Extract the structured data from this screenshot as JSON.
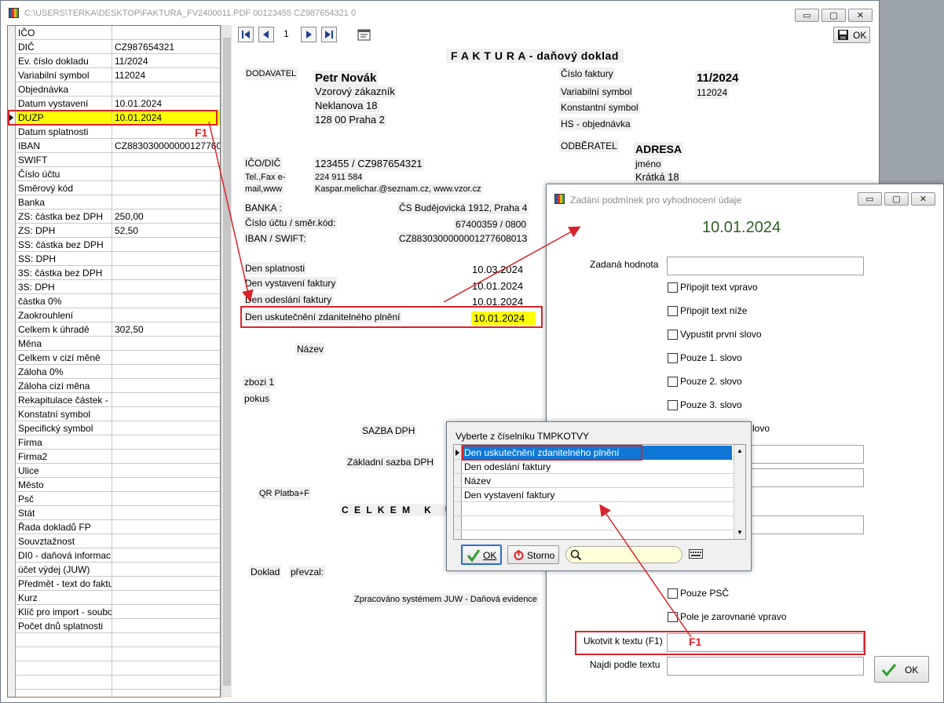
{
  "window": {
    "title": "C:\\USERS\\TERKA\\DESKTOP\\FAKTURA_FV2400011.PDF 00123455 CZ987654321 0",
    "min_glyph": "▭",
    "max_glyph": "▢",
    "close_glyph": "✕"
  },
  "grid": {
    "rows": [
      {
        "key": "IČO",
        "value": ""
      },
      {
        "key": "DIČ",
        "value": "CZ987654321"
      },
      {
        "key": "Ev. číslo dokladu",
        "value": "11/2024"
      },
      {
        "key": "Variabilní symbol",
        "value": "112024"
      },
      {
        "key": "Objednávka",
        "value": ""
      },
      {
        "key": "Datum vystavení",
        "value": "10.01.2024"
      },
      {
        "key": "DUZP",
        "value": "10.01.2024"
      },
      {
        "key": "Datum splatnosti",
        "value": ""
      },
      {
        "key": "IBAN",
        "value": "CZ883030000000127760"
      },
      {
        "key": "SWIFT",
        "value": ""
      },
      {
        "key": "Číslo účtu",
        "value": ""
      },
      {
        "key": "Směrový kód",
        "value": ""
      },
      {
        "key": "Banka",
        "value": ""
      },
      {
        "key": "ZS: částka bez DPH",
        "value": "250,00"
      },
      {
        "key": "ZS: DPH",
        "value": "52,50"
      },
      {
        "key": "SS: částka bez DPH",
        "value": ""
      },
      {
        "key": "SS: DPH",
        "value": ""
      },
      {
        "key": "3S: částka bez DPH",
        "value": ""
      },
      {
        "key": "3S: DPH",
        "value": ""
      },
      {
        "key": "částka 0%",
        "value": ""
      },
      {
        "key": "Zaokrouhlení",
        "value": ""
      },
      {
        "key": "Celkem k úhradě",
        "value": "302,50"
      },
      {
        "key": "Měna",
        "value": ""
      },
      {
        "key": "Celkem v cizí měně",
        "value": ""
      },
      {
        "key": "Záloha 0%",
        "value": ""
      },
      {
        "key": "Záloha cizí měna",
        "value": ""
      },
      {
        "key": "Rekapitulace částek -",
        "value": ""
      },
      {
        "key": "Konstatní symbol",
        "value": ""
      },
      {
        "key": "Specifický symbol",
        "value": ""
      },
      {
        "key": "Firma",
        "value": ""
      },
      {
        "key": "Firma2",
        "value": ""
      },
      {
        "key": "Ulice",
        "value": ""
      },
      {
        "key": "Město",
        "value": ""
      },
      {
        "key": "Psč",
        "value": ""
      },
      {
        "key": "Stát",
        "value": ""
      },
      {
        "key": "Řada dokladů FP",
        "value": ""
      },
      {
        "key": "Souvztažnost",
        "value": ""
      },
      {
        "key": "DI0 - daňová informac",
        "value": ""
      },
      {
        "key": "účet výdej (JUW)",
        "value": ""
      },
      {
        "key": "Předmět - text do faktu",
        "value": ""
      },
      {
        "key": "Kurz",
        "value": ""
      },
      {
        "key": "Klíč pro import - soubo",
        "value": ""
      },
      {
        "key": "Počet dnů splatnosti",
        "value": ""
      },
      {
        "key": "",
        "value": ""
      },
      {
        "key": "",
        "value": ""
      },
      {
        "key": "",
        "value": ""
      },
      {
        "key": "",
        "value": ""
      },
      {
        "key": "",
        "value": ""
      }
    ],
    "selected_index": 6
  },
  "toolbar": {
    "page": "1",
    "ok_label": "OK"
  },
  "pdf": {
    "title": "F A K T U R A - daňový doklad",
    "dodavatel_label": "DODAVATEL",
    "seller_name": "Petr Novák",
    "seller_line1": "Vzorový zákazník",
    "seller_line2": "Neklanova 18",
    "seller_line3": "128 00 Praha 2",
    "cislo_faktury_label": "Číslo faktury",
    "cislo_faktury_value": "11/2024",
    "var_symbol_label": "Variabilní symbol",
    "var_symbol_value": "112024",
    "konst_symbol_label": "Konstantní symbol",
    "hs_label": "HS - objednávka",
    "odberatel_label": "ODBĚRATEL",
    "buyer_name": "ADRESA",
    "buyer_line1": "jméno",
    "buyer_line2": "Krátká 18",
    "ico_label": "IČO/DIČ",
    "ico_value": "123455 / CZ987654321",
    "tel_label1": "Tel.,Fax e-",
    "tel_label2": "mail,www",
    "tel_value": "224 911 584",
    "email_value": "Kaspar.melichar.@seznam.cz, www.vzor.cz",
    "banka_label": "BANKA :",
    "banka_value": "ČS Budějovická 1912, Praha 4",
    "ucet_label": "Číslo účtu / směr.kód:",
    "ucet_value": "67400359 / 0800",
    "iban_label": "IBAN / SWIFT:",
    "iban_value": "CZ883030000000127760801З",
    "splatnost_label": "Den splatnosti",
    "splatnost_value": "10.03.2024",
    "vystaveni_label": "Den vystavení faktury",
    "vystaveni_value": "10.01.2024",
    "odeslani_label": "Den odeslání faktury",
    "odeslani_value": "10.01.2024",
    "duzp_label": "Den uskutečnění zdanitelného plnění",
    "duzp_value": "10.01.2024",
    "nazev_label": "Název",
    "item1": "zbozi 1",
    "item2": "pokus",
    "sazba_label": "SAZBA DPH",
    "zakladni_label": "Základní sazba DPH",
    "qr_label": "QR Platba+F",
    "celkem_label": "C E L K E M   K   Ú",
    "doklad_label": "Doklad",
    "prevzal_label": "převzal:",
    "footer": "Zpracováno systémem JUW - Daňová evidence"
  },
  "annotations": {
    "f1_grid": "F1",
    "f1_dialog": "F1",
    "accent": "#d8232a"
  },
  "dialog": {
    "title": "Zadání podmínek pro vyhodnocení údaje",
    "value": "10.01.2024",
    "zadana_label": "Zadaná hodnota",
    "zadana_value": "",
    "checkboxes": [
      "Připojit text vpravo",
      "Připojit text níže",
      "Vypustit první slovo",
      "Pouze 1. slovo",
      "Pouze 2. slovo",
      "Pouze 3. slovo",
      "lovo"
    ],
    "pouze_psc": "Pouze PSČ",
    "zarovnane": "Pole je zarovnané vpravo",
    "ukotvit_label": "Ukotvit k textu (F1)",
    "najdi_label": "Najdi podle textu",
    "ok_label": "OK"
  },
  "picker": {
    "title": "Vyberte z číselníku TMPKOTVY",
    "items": [
      "Den uskutečnění zdanitelného plnění",
      "Den odeslání faktury",
      "Název",
      "Den vystavení faktury"
    ],
    "ok_label": "OK",
    "storno_label": "Storno",
    "search_value": ""
  }
}
